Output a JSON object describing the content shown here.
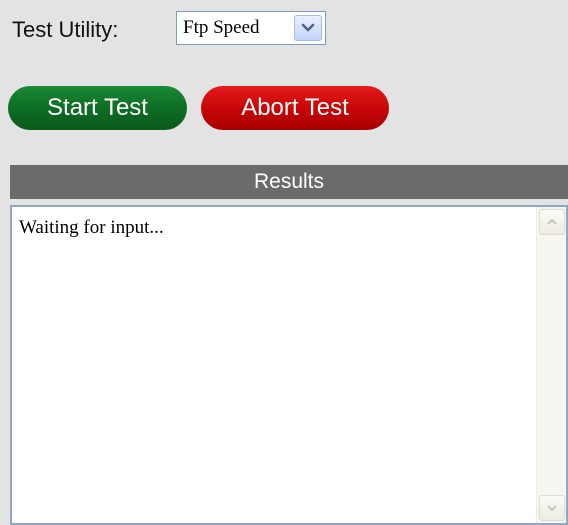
{
  "form": {
    "utility_label": "Test Utility:",
    "utility_selected": "Ftp Speed"
  },
  "buttons": {
    "start_label": "Start Test",
    "abort_label": "Abort Test"
  },
  "results": {
    "header": "Results",
    "text": "Waiting for input..."
  },
  "icons": {
    "select_arrow": "chevron-down-icon",
    "scroll_up": "scroll-up-arrow-icon",
    "scroll_down": "scroll-down-arrow-icon"
  },
  "colors": {
    "start_button": "#0d6b23",
    "abort_button": "#c50606",
    "results_header": "#6b6b6b"
  }
}
